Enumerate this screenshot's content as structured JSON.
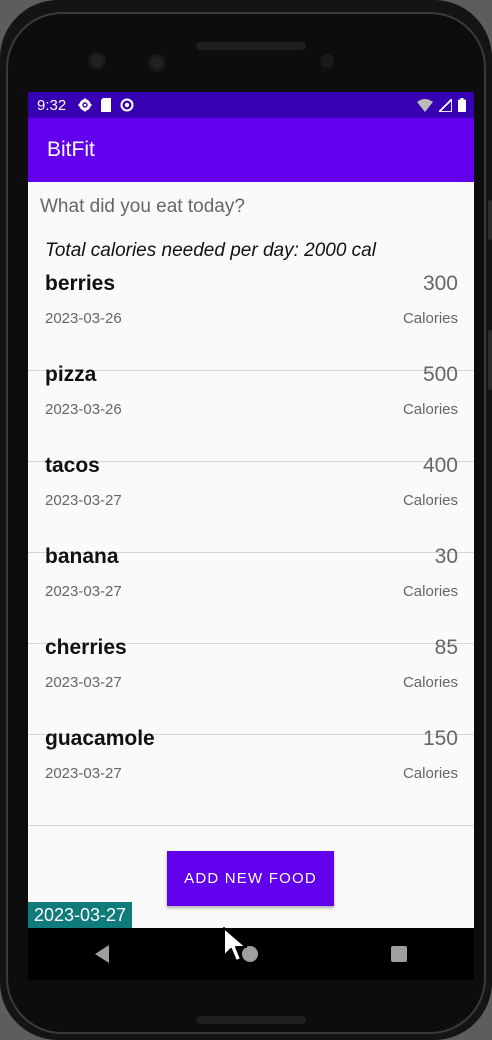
{
  "status_bar": {
    "time": "9:32",
    "left_icons": [
      "gear-icon",
      "sd-card-icon",
      "do-not-disturb-icon"
    ],
    "right_icons": [
      "wifi-icon",
      "signal-icon",
      "battery-icon"
    ]
  },
  "app_bar": {
    "title": "BitFit"
  },
  "main": {
    "prompt": "What did you eat today?",
    "total_calories_text": "Total calories needed per day: 2000 cal",
    "entries": [
      {
        "name": "berries",
        "date": "2023-03-26",
        "calories": "300",
        "unit": "Calories"
      },
      {
        "name": "pizza",
        "date": "2023-03-26",
        "calories": "500",
        "unit": "Calories"
      },
      {
        "name": "tacos",
        "date": "2023-03-27",
        "calories": "400",
        "unit": "Calories"
      },
      {
        "name": "banana",
        "date": "2023-03-27",
        "calories": "30",
        "unit": "Calories"
      },
      {
        "name": "cherries",
        "date": "2023-03-27",
        "calories": "85",
        "unit": "Calories"
      },
      {
        "name": "guacamole",
        "date": "2023-03-27",
        "calories": "150",
        "unit": "Calories"
      }
    ],
    "add_button_label": "ADD NEW FOOD",
    "date_chip": "2023-03-27"
  },
  "colors": {
    "primary": "#6200ee",
    "primary_dark": "#3700b3",
    "date_chip": "#0f7b7b"
  }
}
